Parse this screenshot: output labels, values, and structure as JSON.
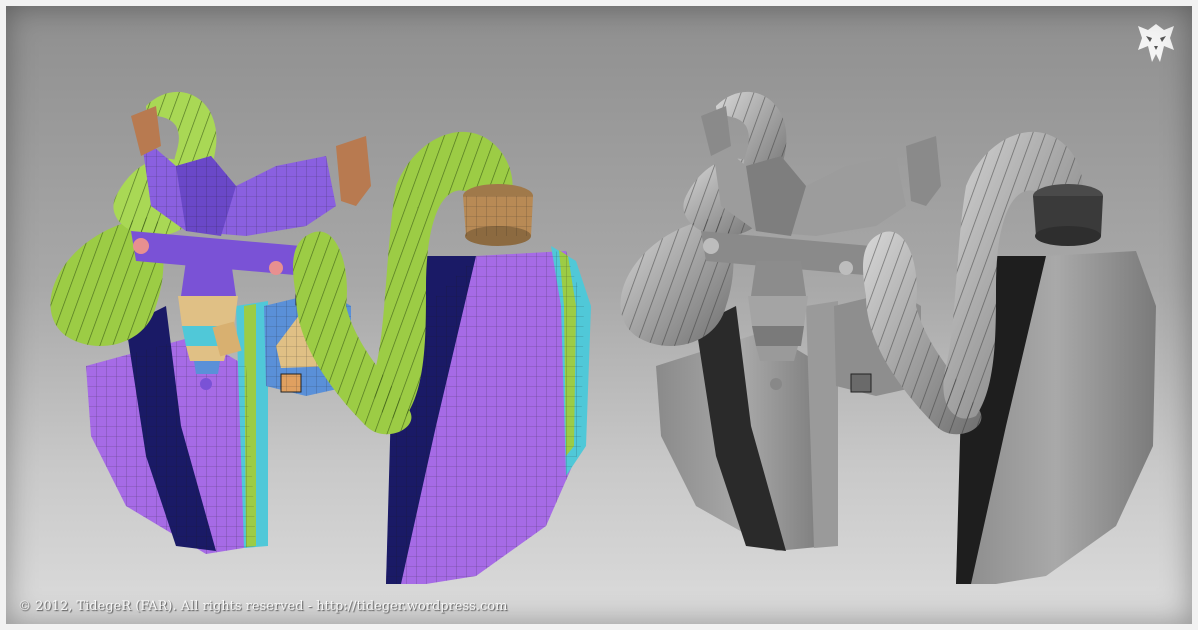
{
  "credit": {
    "copyright_text": "© 2012, TidegeR (FAR). All rights reserved - http://tideger.wordpress.com"
  },
  "logo": {
    "icon": "tribal-skull-logo-icon"
  },
  "colors": {
    "frame_border": "#f2f2f2",
    "purple_panel": "#a66be6",
    "navy_panel": "#1a1a66",
    "green_hose": "#9ccc45",
    "tan_parts": "#e0c085",
    "cyan_trim": "#50c8d8",
    "brown_parts": "#b87a50",
    "gray_render": "#8c8c8c"
  },
  "views": {
    "left": "color-id-wireframe-view",
    "right": "gray-clay-render-view"
  }
}
